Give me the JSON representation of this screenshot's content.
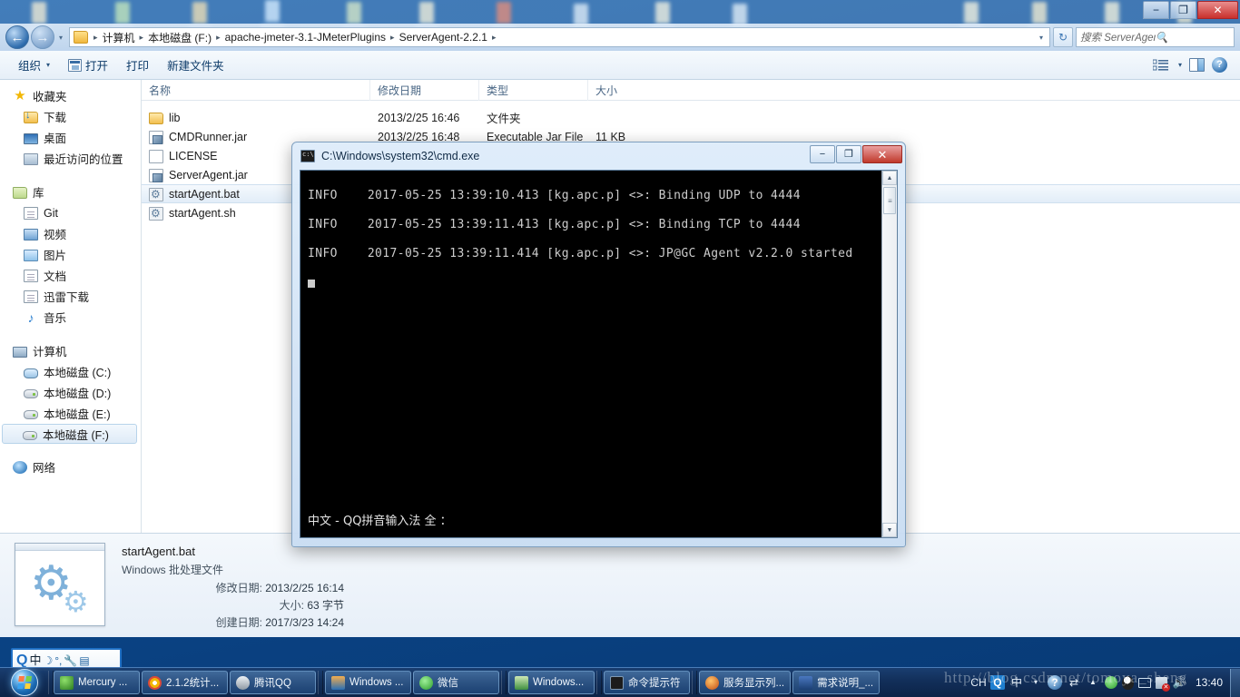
{
  "window": {
    "title_buttons": {
      "minimize": "−",
      "maximize": "❐",
      "close": "✕"
    }
  },
  "address": {
    "back_icon": "←",
    "forward_icon": "→",
    "dropdown_icon": "▾",
    "refresh_icon": "↻",
    "crumbs": [
      "计算机",
      "本地磁盘 (F:)",
      "apache-jmeter-3.1-JMeterPlugins",
      "ServerAgent-2.2.1"
    ],
    "separator": "▸",
    "search_placeholder": "搜索 ServerAgent-...",
    "search_icon": "🔍"
  },
  "toolbar": {
    "organize": "组织",
    "open": "打开",
    "print": "打印",
    "new_folder": "新建文件夹",
    "caret": "▾",
    "help_glyph": "?"
  },
  "navpane": {
    "favorites": {
      "label": "收藏夹",
      "items": [
        "下载",
        "桌面",
        "最近访问的位置"
      ]
    },
    "libraries": {
      "label": "库",
      "items": [
        "Git",
        "视频",
        "图片",
        "文档",
        "迅雷下载",
        "音乐"
      ]
    },
    "computer": {
      "label": "计算机",
      "items": [
        "本地磁盘 (C:)",
        "本地磁盘 (D:)",
        "本地磁盘 (E:)",
        "本地磁盘 (F:)"
      ],
      "selected": "本地磁盘 (F:)"
    },
    "network": {
      "label": "网络"
    }
  },
  "filelist": {
    "columns": [
      "名称",
      "修改日期",
      "类型",
      "大小"
    ],
    "rows": [
      {
        "name": "lib",
        "date": "2013/2/25 16:46",
        "type": "文件夹",
        "size": "",
        "icon": "folder",
        "selected": false
      },
      {
        "name": "CMDRunner.jar",
        "date": "2013/2/25 16:48",
        "type": "Executable Jar File",
        "size": "11 KB",
        "icon": "jar",
        "selected": false
      },
      {
        "name": "LICENSE",
        "date": "",
        "type": "",
        "size": "",
        "icon": "plain",
        "selected": false
      },
      {
        "name": "ServerAgent.jar",
        "date": "",
        "type": "",
        "size": "",
        "icon": "jar",
        "selected": false
      },
      {
        "name": "startAgent.bat",
        "date": "",
        "type": "",
        "size": "",
        "icon": "bat",
        "selected": true
      },
      {
        "name": "startAgent.sh",
        "date": "",
        "type": "",
        "size": "",
        "icon": "bat",
        "selected": false
      }
    ]
  },
  "details": {
    "filename": "startAgent.bat",
    "filetype": "Windows 批处理文件",
    "modified_label": "修改日期:",
    "modified_value": "2013/2/25 16:14",
    "size_label": "大小:",
    "size_value": "63 字节",
    "created_label": "创建日期:",
    "created_value": "2017/3/23 14:24"
  },
  "ime_toolbar": {
    "logo": "Q",
    "mode": "中",
    "moon_icon": "☽",
    "punct_icon": "°,",
    "wrench_icon": "🔧",
    "box_icon": "▤"
  },
  "cmd": {
    "title": "C:\\Windows\\system32\\cmd.exe",
    "buttons": {
      "minimize": "−",
      "maximize": "❐",
      "close": "✕"
    },
    "lines": [
      "INFO    2017-05-25 13:39:10.413 [kg.apc.p] <>: Binding UDP to 4444",
      "INFO    2017-05-25 13:39:11.413 [kg.apc.p] <>: Binding TCP to 4444",
      "INFO    2017-05-25 13:39:11.414 [kg.apc.p] <>: JP@GC Agent v2.2.0 started"
    ],
    "ime_status": "中文 - QQ拼音输入法 全 ：",
    "scroll_up": "▲",
    "scroll_down": "▼",
    "thumb_grip": "≡"
  },
  "taskbar": {
    "start_tooltip": "开始",
    "tasks": [
      {
        "label": "Mercury ...",
        "color1": "#6fbf4a",
        "color2": "#2a7a1f"
      },
      {
        "label": "2.1.2统计...",
        "color1": "#f2b705",
        "color2": "#d94a38"
      },
      {
        "label": "腾讯QQ",
        "color1": "#d8dde2",
        "color2": "#8f9aa4"
      },
      {
        "label": "Windows ...",
        "color1": "#e8a33d",
        "color2": "#2a6fb5"
      },
      {
        "label": "微信",
        "color1": "#6fd36a",
        "color2": "#2a9b2a"
      },
      {
        "label": "Windows...",
        "color1": "#8fd16f",
        "color2": "#3f8f3f"
      },
      {
        "label": "命令提示符",
        "color1": "#1c1c1c",
        "color2": "#3c3c3c"
      },
      {
        "label": "服务显示列...",
        "color1": "#f2892a",
        "color2": "#c04a10"
      },
      {
        "label": "需求说明_...",
        "color1": "#2b5797",
        "color2": "#1b3f73"
      }
    ],
    "tray": {
      "lang": "CH",
      "qq_logo": "Q",
      "ime_mode": "中",
      "ime_caret": "▾",
      "help": "?",
      "sync": "⇄",
      "overflow": "▲",
      "wechat": "✆",
      "qq_penguin": "🐧",
      "monitor": "🖥",
      "network_error": "⚑",
      "volume": "🔊"
    },
    "clock": "13:40"
  },
  "watermark": "http://blog.csdn.net/tomoya_sheng",
  "colors": {
    "desktop_blue": "#0b4d96",
    "accent": "#1f6fc4",
    "selection": "#dfebf7",
    "console_bg": "#000000",
    "console_fg": "#cccccc"
  }
}
